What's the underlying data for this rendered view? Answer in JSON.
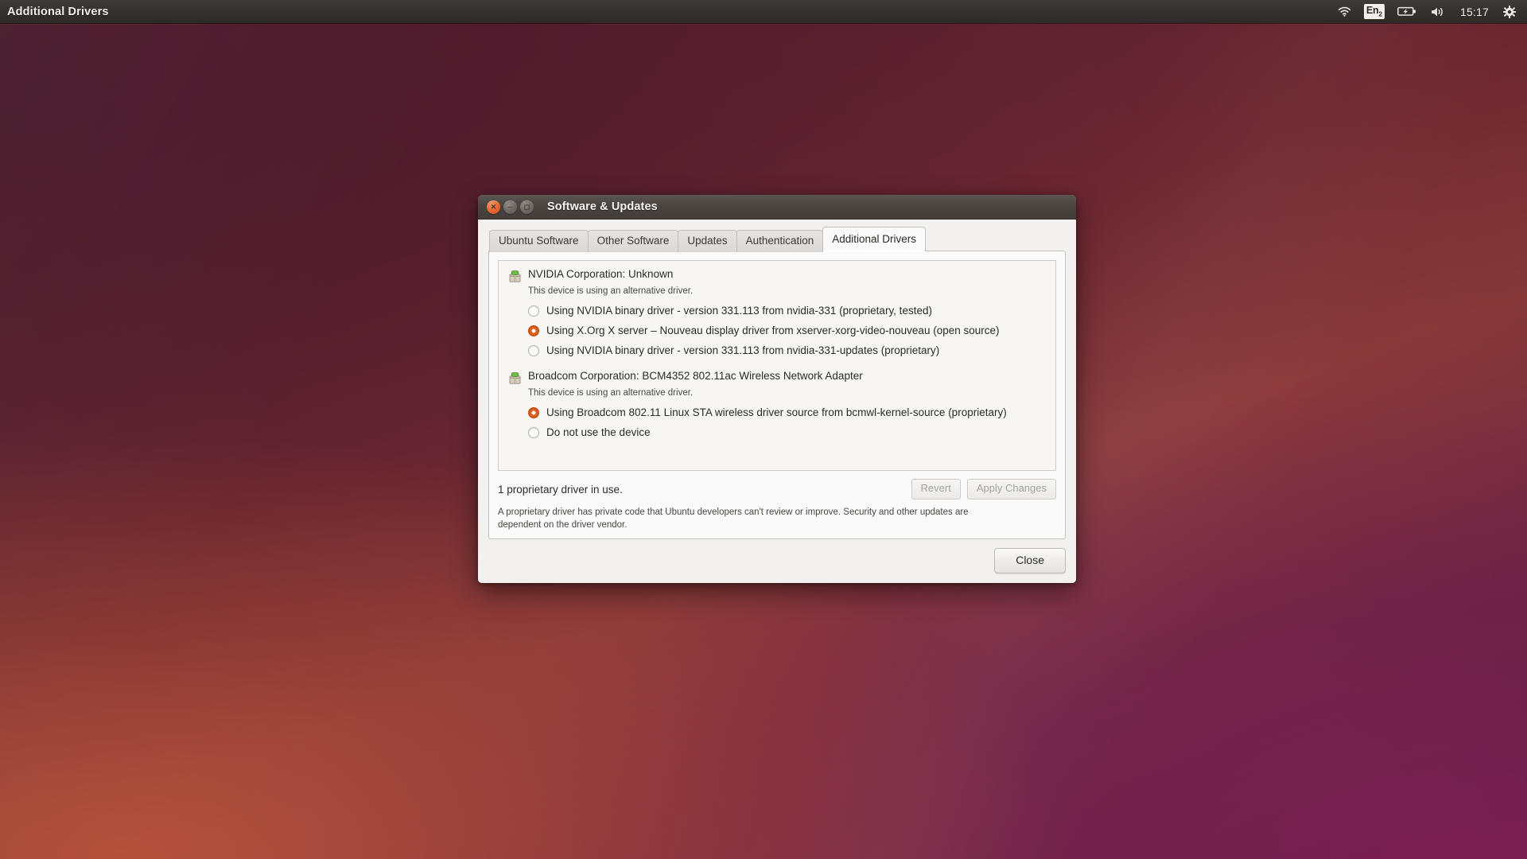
{
  "panel": {
    "title": "Additional Drivers",
    "indicators": {
      "wifi_icon": "wifi-icon",
      "keyboard_layout": "En",
      "keyboard_layout_sub": "2",
      "battery_icon": "battery-charging-icon",
      "volume_icon": "volume-icon",
      "clock": "15:17",
      "session_icon": "gear-icon"
    }
  },
  "window": {
    "title": "Software & Updates",
    "buttons": {
      "close": "close-window-button",
      "minimize": "minimize-window-button",
      "maximize": "maximize-window-button"
    }
  },
  "tabs": [
    {
      "label": "Ubuntu Software",
      "active": false
    },
    {
      "label": "Other Software",
      "active": false
    },
    {
      "label": "Updates",
      "active": false
    },
    {
      "label": "Authentication",
      "active": false
    },
    {
      "label": "Additional Drivers",
      "active": true
    }
  ],
  "devices": [
    {
      "name": "NVIDIA Corporation: Unknown",
      "status": "This device is using an alternative driver.",
      "options": [
        {
          "label": "Using NVIDIA binary driver - version 331.113 from nvidia-331 (proprietary, tested)",
          "selected": false
        },
        {
          "label": "Using X.Org X server – Nouveau display driver from xserver-xorg-video-nouveau (open source)",
          "selected": true
        },
        {
          "label": "Using NVIDIA binary driver - version 331.113 from nvidia-331-updates (proprietary)",
          "selected": false
        }
      ]
    },
    {
      "name": "Broadcom Corporation: BCM4352 802.11ac Wireless Network Adapter",
      "status": "This device is using an alternative driver.",
      "options": [
        {
          "label": "Using Broadcom 802.11 Linux STA wireless driver source from bcmwl-kernel-source (proprietary)",
          "selected": true
        },
        {
          "label": "Do not use the device",
          "selected": false
        }
      ]
    }
  ],
  "footer": {
    "status": "1 proprietary driver in use.",
    "revert_label": "Revert",
    "apply_label": "Apply Changes",
    "note": "A proprietary driver has private code that Ubuntu developers can't review or improve. Security and other updates are dependent on the driver vendor.",
    "close_label": "Close"
  },
  "colors": {
    "accent_orange": "#e2611f",
    "window_titlebar": "#4a4441",
    "panel_background": "#34302d",
    "desktop_top_left": "#4e1c2e",
    "desktop_bottom_left": "#b5563e",
    "desktop_bottom_right": "#6e1f4b"
  }
}
